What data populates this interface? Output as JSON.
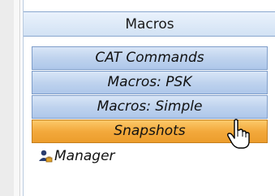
{
  "panel": {
    "header": "Macros",
    "items": [
      {
        "label": "CAT Commands",
        "active": false
      },
      {
        "label": "Macros: PSK",
        "active": false
      },
      {
        "label": "Macros: Simple",
        "active": false
      },
      {
        "label": "Snapshots",
        "active": true
      }
    ],
    "manager": {
      "label": "Manager",
      "icon": "user-manager-icon"
    }
  },
  "colors": {
    "header_bg": "#d2e2f4",
    "item_bg": "#bfd3ee",
    "active_bg": "#f3a93c",
    "border": "#7e9dc9"
  },
  "cursor": {
    "icon": "hand-pointer-icon"
  }
}
